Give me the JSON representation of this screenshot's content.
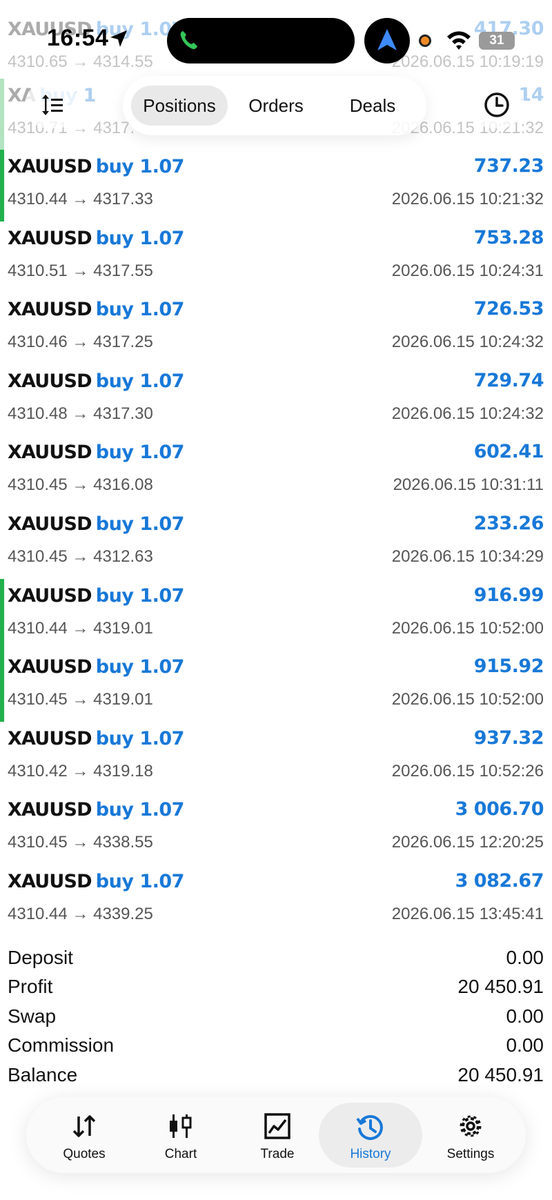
{
  "status_bar": {
    "time": "16:54",
    "battery": "31"
  },
  "toolbar": {
    "tabs": [
      {
        "label": "Positions",
        "active": true
      },
      {
        "label": "Orders",
        "active": false
      },
      {
        "label": "Deals",
        "active": false
      }
    ],
    "sort_icon": "sort-icon",
    "history_icon": "clock-icon"
  },
  "faded_rows": [
    {
      "symbol": "XAUUSD",
      "side": "buy 1.07",
      "prices": "4310.65 → 4314.55",
      "profit": "417.30",
      "date": "2026.06.15 10:19:19"
    },
    {
      "symbol": "XA",
      "side": "buy 1",
      "prices": "4310.71 → 4317.",
      "profit": "14",
      "date": "2026.06.15 10:21:32"
    }
  ],
  "deals": [
    {
      "symbol": "XAUUSD",
      "side": "buy 1.07",
      "prices": "4310.44 → 4317.33",
      "profit": "737.23",
      "date": "2026.06.15 10:21:32",
      "marked": true
    },
    {
      "symbol": "XAUUSD",
      "side": "buy 1.07",
      "prices": "4310.51 → 4317.55",
      "profit": "753.28",
      "date": "2026.06.15 10:24:31",
      "marked": false
    },
    {
      "symbol": "XAUUSD",
      "side": "buy 1.07",
      "prices": "4310.46 → 4317.25",
      "profit": "726.53",
      "date": "2026.06.15 10:24:32",
      "marked": false
    },
    {
      "symbol": "XAUUSD",
      "side": "buy 1.07",
      "prices": "4310.48 → 4317.30",
      "profit": "729.74",
      "date": "2026.06.15 10:24:32",
      "marked": false
    },
    {
      "symbol": "XAUUSD",
      "side": "buy 1.07",
      "prices": "4310.45 → 4316.08",
      "profit": "602.41",
      "date": "2026.06.15 10:31:11",
      "marked": false
    },
    {
      "symbol": "XAUUSD",
      "side": "buy 1.07",
      "prices": "4310.45 → 4312.63",
      "profit": "233.26",
      "date": "2026.06.15 10:34:29",
      "marked": false
    },
    {
      "symbol": "XAUUSD",
      "side": "buy 1.07",
      "prices": "4310.44 → 4319.01",
      "profit": "916.99",
      "date": "2026.06.15 10:52:00",
      "marked": true
    },
    {
      "symbol": "XAUUSD",
      "side": "buy 1.07",
      "prices": "4310.45 → 4319.01",
      "profit": "915.92",
      "date": "2026.06.15 10:52:00",
      "marked": true
    },
    {
      "symbol": "XAUUSD",
      "side": "buy 1.07",
      "prices": "4310.42 → 4319.18",
      "profit": "937.32",
      "date": "2026.06.15 10:52:26",
      "marked": false
    },
    {
      "symbol": "XAUUSD",
      "side": "buy 1.07",
      "prices": "4310.45 → 4338.55",
      "profit": "3 006.70",
      "date": "2026.06.15 12:20:25",
      "marked": false
    },
    {
      "symbol": "XAUUSD",
      "side": "buy 1.07",
      "prices": "4310.44 → 4339.25",
      "profit": "3 082.67",
      "date": "2026.06.15 13:45:41",
      "marked": false
    }
  ],
  "summary": [
    {
      "label": "Deposit",
      "value": "0.00"
    },
    {
      "label": "Profit",
      "value": "20 450.91"
    },
    {
      "label": "Swap",
      "value": "0.00"
    },
    {
      "label": "Commission",
      "value": "0.00"
    },
    {
      "label": "Balance",
      "value": "20 450.91"
    }
  ],
  "tabbar": [
    {
      "label": "Quotes",
      "icon": "quotes-icon",
      "active": false
    },
    {
      "label": "Chart",
      "icon": "candlestick-icon",
      "active": false
    },
    {
      "label": "Trade",
      "icon": "trade-chart-icon",
      "active": false
    },
    {
      "label": "History",
      "icon": "history-icon",
      "active": true
    },
    {
      "label": "Settings",
      "icon": "gear-icon",
      "active": false
    }
  ],
  "colors": {
    "accent": "#1878d8",
    "marker": "#22b14c"
  }
}
